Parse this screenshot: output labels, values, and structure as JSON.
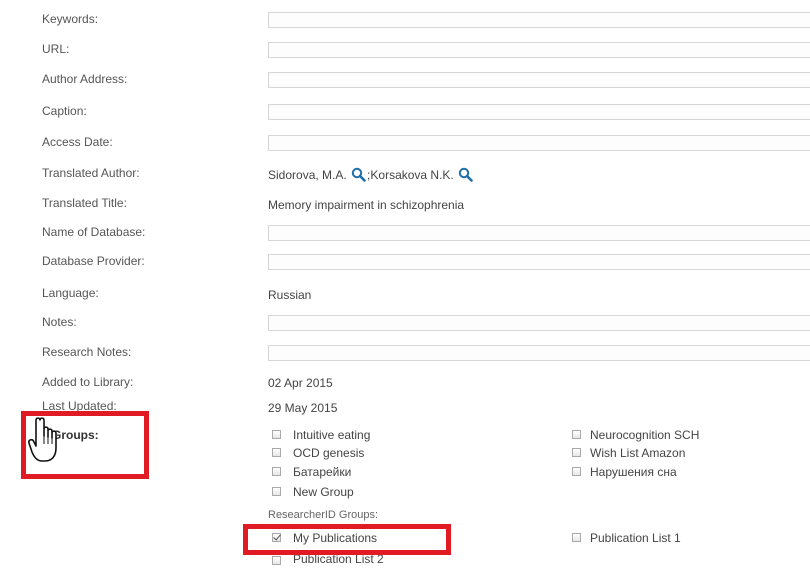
{
  "labels": {
    "keywords": "Keywords:",
    "url": "URL:",
    "author_address": "Author Address:",
    "caption": "Caption:",
    "access_date": "Access Date:",
    "translated_author": "Translated Author:",
    "translated_title": "Translated Title:",
    "name_of_database": "Name of Database:",
    "database_provider": "Database Provider:",
    "language": "Language:",
    "notes": "Notes:",
    "research_notes": "Research Notes:",
    "added_to_library": "Added to Library:",
    "last_updated": "Last Updated:",
    "groups": "Groups:"
  },
  "values": {
    "keywords": "",
    "url": "",
    "author_address": "",
    "caption": "",
    "access_date": "",
    "translated_author_1": "Sidorova, M.A.",
    "author_separator": ";",
    "translated_author_2": "Korsakova N.K.",
    "translated_title": "Memory impairment in schizophrenia",
    "name_of_database": "",
    "database_provider": "",
    "language": "Russian",
    "notes": "",
    "research_notes": "",
    "added_to_library": "02 Apr 2015",
    "last_updated": "29 May 2015"
  },
  "groups": {
    "left": [
      {
        "label": "Intuitive eating",
        "checked": false
      },
      {
        "label": "OCD genesis",
        "checked": false
      },
      {
        "label": "Батарейки",
        "checked": false
      },
      {
        "label": "New Group",
        "checked": false
      }
    ],
    "right": [
      {
        "label": "Neurocognition SCH",
        "checked": false
      },
      {
        "label": "Wish List Amazon",
        "checked": false
      },
      {
        "label": "Нарушения сна",
        "checked": false
      }
    ],
    "researcherid_heading": "ResearcherID Groups:",
    "researcherid": [
      {
        "label": "My Publications",
        "checked": true
      },
      {
        "label": "Publication List 1",
        "checked": false
      },
      {
        "label": "Publication List 2",
        "checked": false
      }
    ]
  },
  "icons": {
    "search": "magnifier-icon",
    "cursor": "hand-pointer-icon"
  },
  "colors": {
    "highlight": "#e01b24",
    "search_icon": "#1e6fa8"
  }
}
